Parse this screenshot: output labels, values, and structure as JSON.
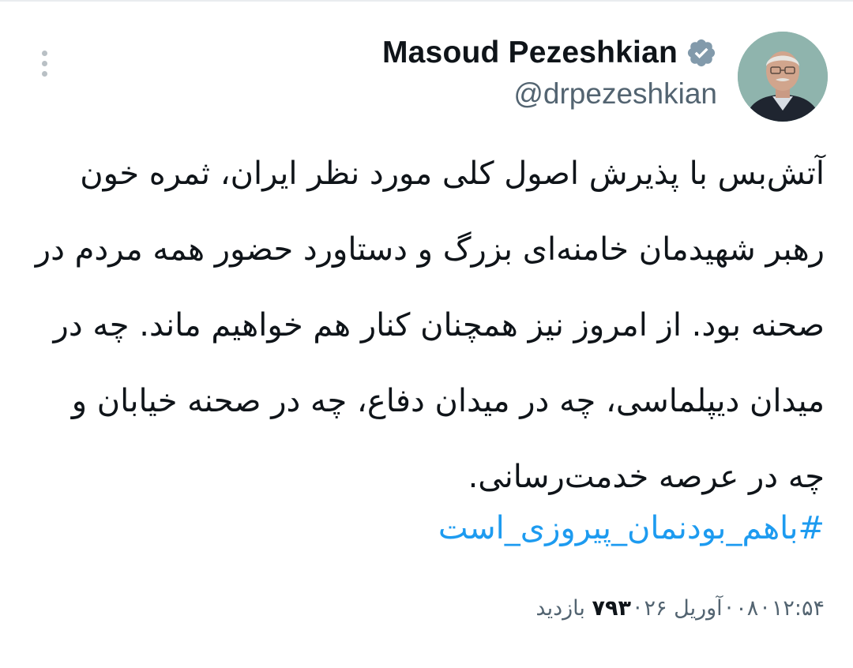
{
  "author": {
    "display_name": "Masoud Pezeshkian",
    "handle": "@drpezeshkian",
    "verified_icon": "verified-badge-icon",
    "avatar": "profile-photo"
  },
  "tweet": {
    "text": "آتش‌بس با پذیرش اصول کلی مورد نظر ایران، ثمره خون رهبر شهیدمان خامنه‌ای بزرگ و دستاورد حضور همه مردم در صحنه بود. از امروز نیز همچنان کنار هم خواهیم ماند. چه در میدان دیپلماسی، چه در میدان دفاع، چه در صحنه خیابان و چه در عرصه خدمت‌رسانی.",
    "hashtag": "#باهم_بودنمان_پیروزی_است"
  },
  "meta": {
    "time": "۱۲:۵۴",
    "date_part1": "۰۸",
    "date_part2": "آوریل ۲۶",
    "separator": "·",
    "views_count": "۷۹۳",
    "views_label": "بازدید"
  },
  "colors": {
    "accent": "#1d9bf0",
    "text_primary": "#0f1419",
    "text_secondary": "#536471"
  }
}
